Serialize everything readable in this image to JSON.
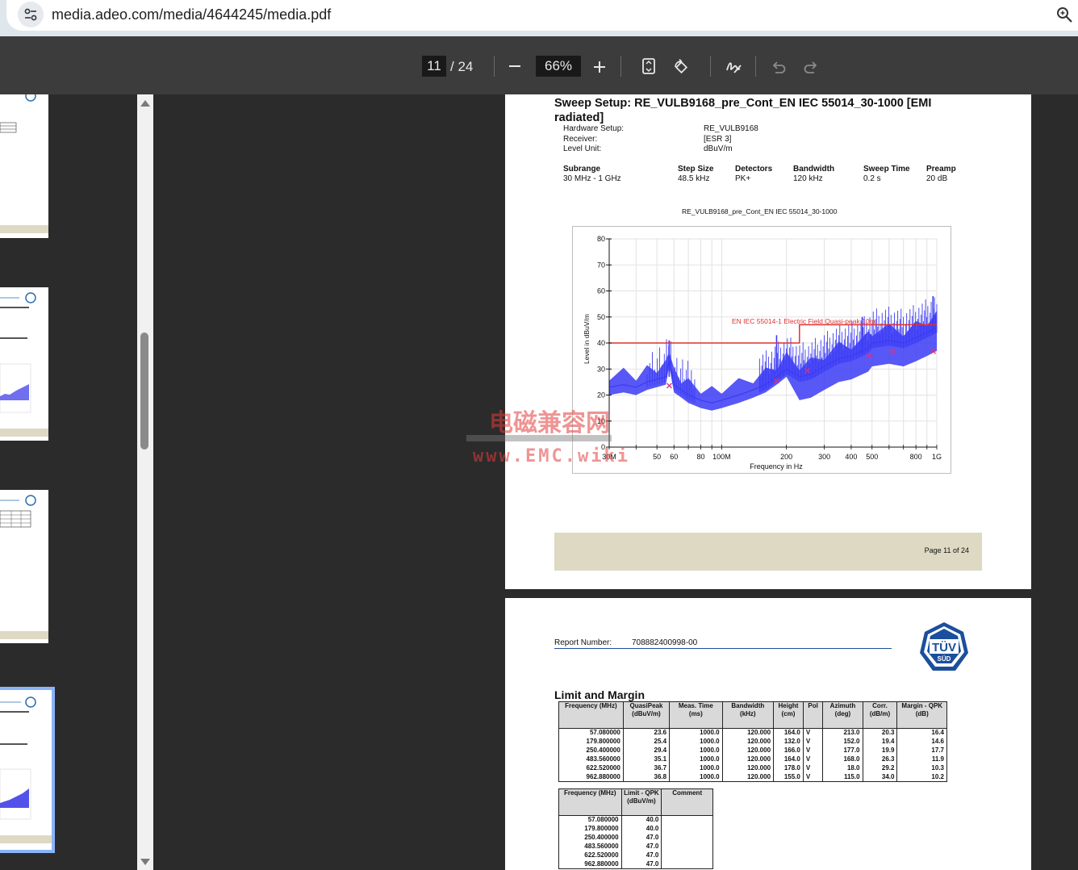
{
  "browser": {
    "url": "media.adeo.com/media/4644245/media.pdf"
  },
  "viewer": {
    "current_page": "11",
    "total_pages": "/ 24",
    "zoom": "66%"
  },
  "page11": {
    "heading": "Sweep Setup: RE_VULB9168_pre_Cont_EN IEC 55014_30-1000 [EMI",
    "heading_line2": "radiated]",
    "setup": [
      {
        "label": "Hardware Setup:",
        "value": "RE_VULB9168"
      },
      {
        "label": "Receiver:",
        "value": "[ESR 3]"
      },
      {
        "label": "Level Unit:",
        "value": "dBuV/m"
      }
    ],
    "sweep_headers": [
      "Subrange",
      "Step Size",
      "Detectors",
      "Bandwidth",
      "Sweep Time",
      "Preamp"
    ],
    "sweep_values": [
      "30 MHz - 1 GHz",
      "48.5 kHz",
      "PK+",
      "120 kHz",
      "0.2 s",
      "20 dB"
    ],
    "footer": "Page 11 of 24"
  },
  "chart_data": {
    "type": "line",
    "title": "RE_VULB9168_pre_Cont_EN IEC 55014_30-1000",
    "xlabel": "Frequency in Hz",
    "ylabel": "Level in dBuV/m",
    "x_scale": "log",
    "xlim": [
      30,
      1000
    ],
    "ylim": [
      0,
      80
    ],
    "x_ticks": [
      {
        "value": 30,
        "label": "30M"
      },
      {
        "value": 50,
        "label": "50"
      },
      {
        "value": 60,
        "label": "60"
      },
      {
        "value": 80,
        "label": "80"
      },
      {
        "value": 100,
        "label": "100M"
      },
      {
        "value": 200,
        "label": "200"
      },
      {
        "value": 300,
        "label": "300"
      },
      {
        "value": 400,
        "label": "400"
      },
      {
        "value": 500,
        "label": "500"
      },
      {
        "value": 800,
        "label": "800"
      },
      {
        "value": 1000,
        "label": "1G"
      }
    ],
    "y_ticks": [
      0,
      10,
      20,
      30,
      40,
      50,
      60,
      70,
      80
    ],
    "grid": true,
    "limit_label": "EN IEC 55014-1 Electric Field Quasi-peak 10m",
    "limit_line": [
      {
        "x": 30,
        "y": 40
      },
      {
        "x": 230,
        "y": 40
      },
      {
        "x": 230,
        "y": 47
      },
      {
        "x": 1000,
        "y": 47
      }
    ],
    "trace": [
      {
        "x": 30,
        "y": 23
      },
      {
        "x": 35,
        "y": 24
      },
      {
        "x": 40,
        "y": 23
      },
      {
        "x": 45,
        "y": 25
      },
      {
        "x": 50,
        "y": 26
      },
      {
        "x": 55,
        "y": 27
      },
      {
        "x": 57,
        "y": 34
      },
      {
        "x": 60,
        "y": 24
      },
      {
        "x": 65,
        "y": 22
      },
      {
        "x": 70,
        "y": 20
      },
      {
        "x": 80,
        "y": 18
      },
      {
        "x": 90,
        "y": 17
      },
      {
        "x": 100,
        "y": 18
      },
      {
        "x": 120,
        "y": 20
      },
      {
        "x": 140,
        "y": 22
      },
      {
        "x": 160,
        "y": 24
      },
      {
        "x": 180,
        "y": 27
      },
      {
        "x": 200,
        "y": 30
      },
      {
        "x": 230,
        "y": 27
      },
      {
        "x": 260,
        "y": 28
      },
      {
        "x": 300,
        "y": 31
      },
      {
        "x": 350,
        "y": 34
      },
      {
        "x": 400,
        "y": 35
      },
      {
        "x": 480,
        "y": 38
      },
      {
        "x": 500,
        "y": 40
      },
      {
        "x": 600,
        "y": 41
      },
      {
        "x": 700,
        "y": 40
      },
      {
        "x": 800,
        "y": 42
      },
      {
        "x": 900,
        "y": 44
      },
      {
        "x": 1000,
        "y": 46
      }
    ],
    "peaks": [
      {
        "x": 57,
        "y": 41
      },
      {
        "x": 180,
        "y": 43
      },
      {
        "x": 450,
        "y": 50
      },
      {
        "x": 960,
        "y": 58
      }
    ],
    "markers": [
      {
        "x": 57.08,
        "y": 23.6
      },
      {
        "x": 179.8,
        "y": 25.4
      },
      {
        "x": 250.4,
        "y": 29.4
      },
      {
        "x": 483.56,
        "y": 35.1
      },
      {
        "x": 622.52,
        "y": 36.7
      },
      {
        "x": 962.88,
        "y": 36.8
      }
    ]
  },
  "page12": {
    "report_label": "Report Number:",
    "report_number": "708882400998-00",
    "logo_text": "TÜV",
    "logo_sub": "SÜD",
    "section_title": "Limit and Margin",
    "table1_headers": [
      "Frequency (MHz)",
      "QuasiPeak (dBuV/m)",
      "Meas. Time (ms)",
      "Bandwidth (kHz)",
      "Height (cm)",
      "Pol",
      "Azimuth (deg)",
      "Corr. (dB/m)",
      "Margin - QPK (dB)"
    ],
    "table1_rows": [
      [
        "57.080000",
        "23.6",
        "1000.0",
        "120.000",
        "164.0",
        "V",
        "213.0",
        "20.3",
        "16.4"
      ],
      [
        "179.800000",
        "25.4",
        "1000.0",
        "120.000",
        "132.0",
        "V",
        "152.0",
        "19.4",
        "14.6"
      ],
      [
        "250.400000",
        "29.4",
        "1000.0",
        "120.000",
        "166.0",
        "V",
        "177.0",
        "19.9",
        "17.7"
      ],
      [
        "483.560000",
        "35.1",
        "1000.0",
        "120.000",
        "164.0",
        "V",
        "168.0",
        "26.3",
        "11.9"
      ],
      [
        "622.520000",
        "36.7",
        "1000.0",
        "120.000",
        "178.0",
        "V",
        "18.0",
        "29.2",
        "10.3"
      ],
      [
        "962.880000",
        "36.8",
        "1000.0",
        "120.000",
        "155.0",
        "V",
        "115.0",
        "34.0",
        "10.2"
      ]
    ],
    "table2_headers": [
      "Frequency (MHz)",
      "Limit - QPK (dBuV/m)",
      "Comment"
    ],
    "table2_rows": [
      [
        "57.080000",
        "40.0",
        ""
      ],
      [
        "179.800000",
        "40.0",
        ""
      ],
      [
        "250.400000",
        "47.0",
        ""
      ],
      [
        "483.560000",
        "47.0",
        ""
      ],
      [
        "622.520000",
        "47.0",
        ""
      ],
      [
        "962.880000",
        "47.0",
        ""
      ]
    ]
  },
  "watermark": {
    "line1": "电磁兼容网",
    "line2": "www.EMC.wiki"
  },
  "colors": {
    "trace": "#3b3bf5",
    "limit": "#e03030",
    "marker": "#e0307a",
    "footer_band": "#ddd9c3",
    "logo": "#1b4f9c"
  }
}
